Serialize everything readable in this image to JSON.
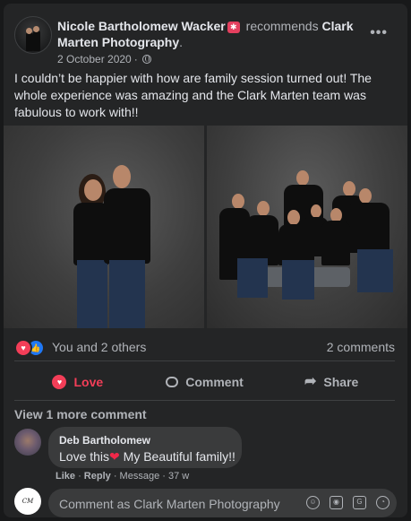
{
  "post": {
    "author": "Nicole Bartholomew Wacker",
    "recommends_text": "recommends",
    "page_name": "Clark Marten Photography",
    "page_name_suffix": ".",
    "date": "2 October 2020",
    "date_sep": "·",
    "body": "I couldn’t be happier with how are family session turned out! The whole experience was amazing and the Clark Marten team was fabulous to work with!!"
  },
  "icons": {
    "more": "more-options-icon",
    "audience": "globe-icon",
    "love": "love-reaction-icon",
    "like": "like-reaction-icon",
    "comment": "comment-icon",
    "share": "share-icon",
    "emoji": "emoji-icon",
    "camera": "camera-icon",
    "gif": "gif-icon",
    "sticker": "sticker-icon"
  },
  "reactions": {
    "summary": "You and 2 others",
    "comments_count": "2 comments"
  },
  "actions": {
    "love_label": "Love",
    "comment_label": "Comment",
    "share_label": "Share"
  },
  "comments": {
    "view_more": "View 1 more comment",
    "items": [
      {
        "author": "Deb Bartholomew",
        "text_before": "Love this",
        "heart": "❤",
        "text_after": " My Beautiful family!!",
        "like_label": "Like",
        "reply_label": "Reply",
        "message_label": "Message",
        "age": "37 w"
      }
    ]
  },
  "composer": {
    "placeholder": "Comment as Clark Marten Photography"
  },
  "colors": {
    "background": "#18191a",
    "card": "#242526",
    "love_red": "#f33e58",
    "like_blue": "#2078f4",
    "bubble": "#3a3b3c"
  }
}
